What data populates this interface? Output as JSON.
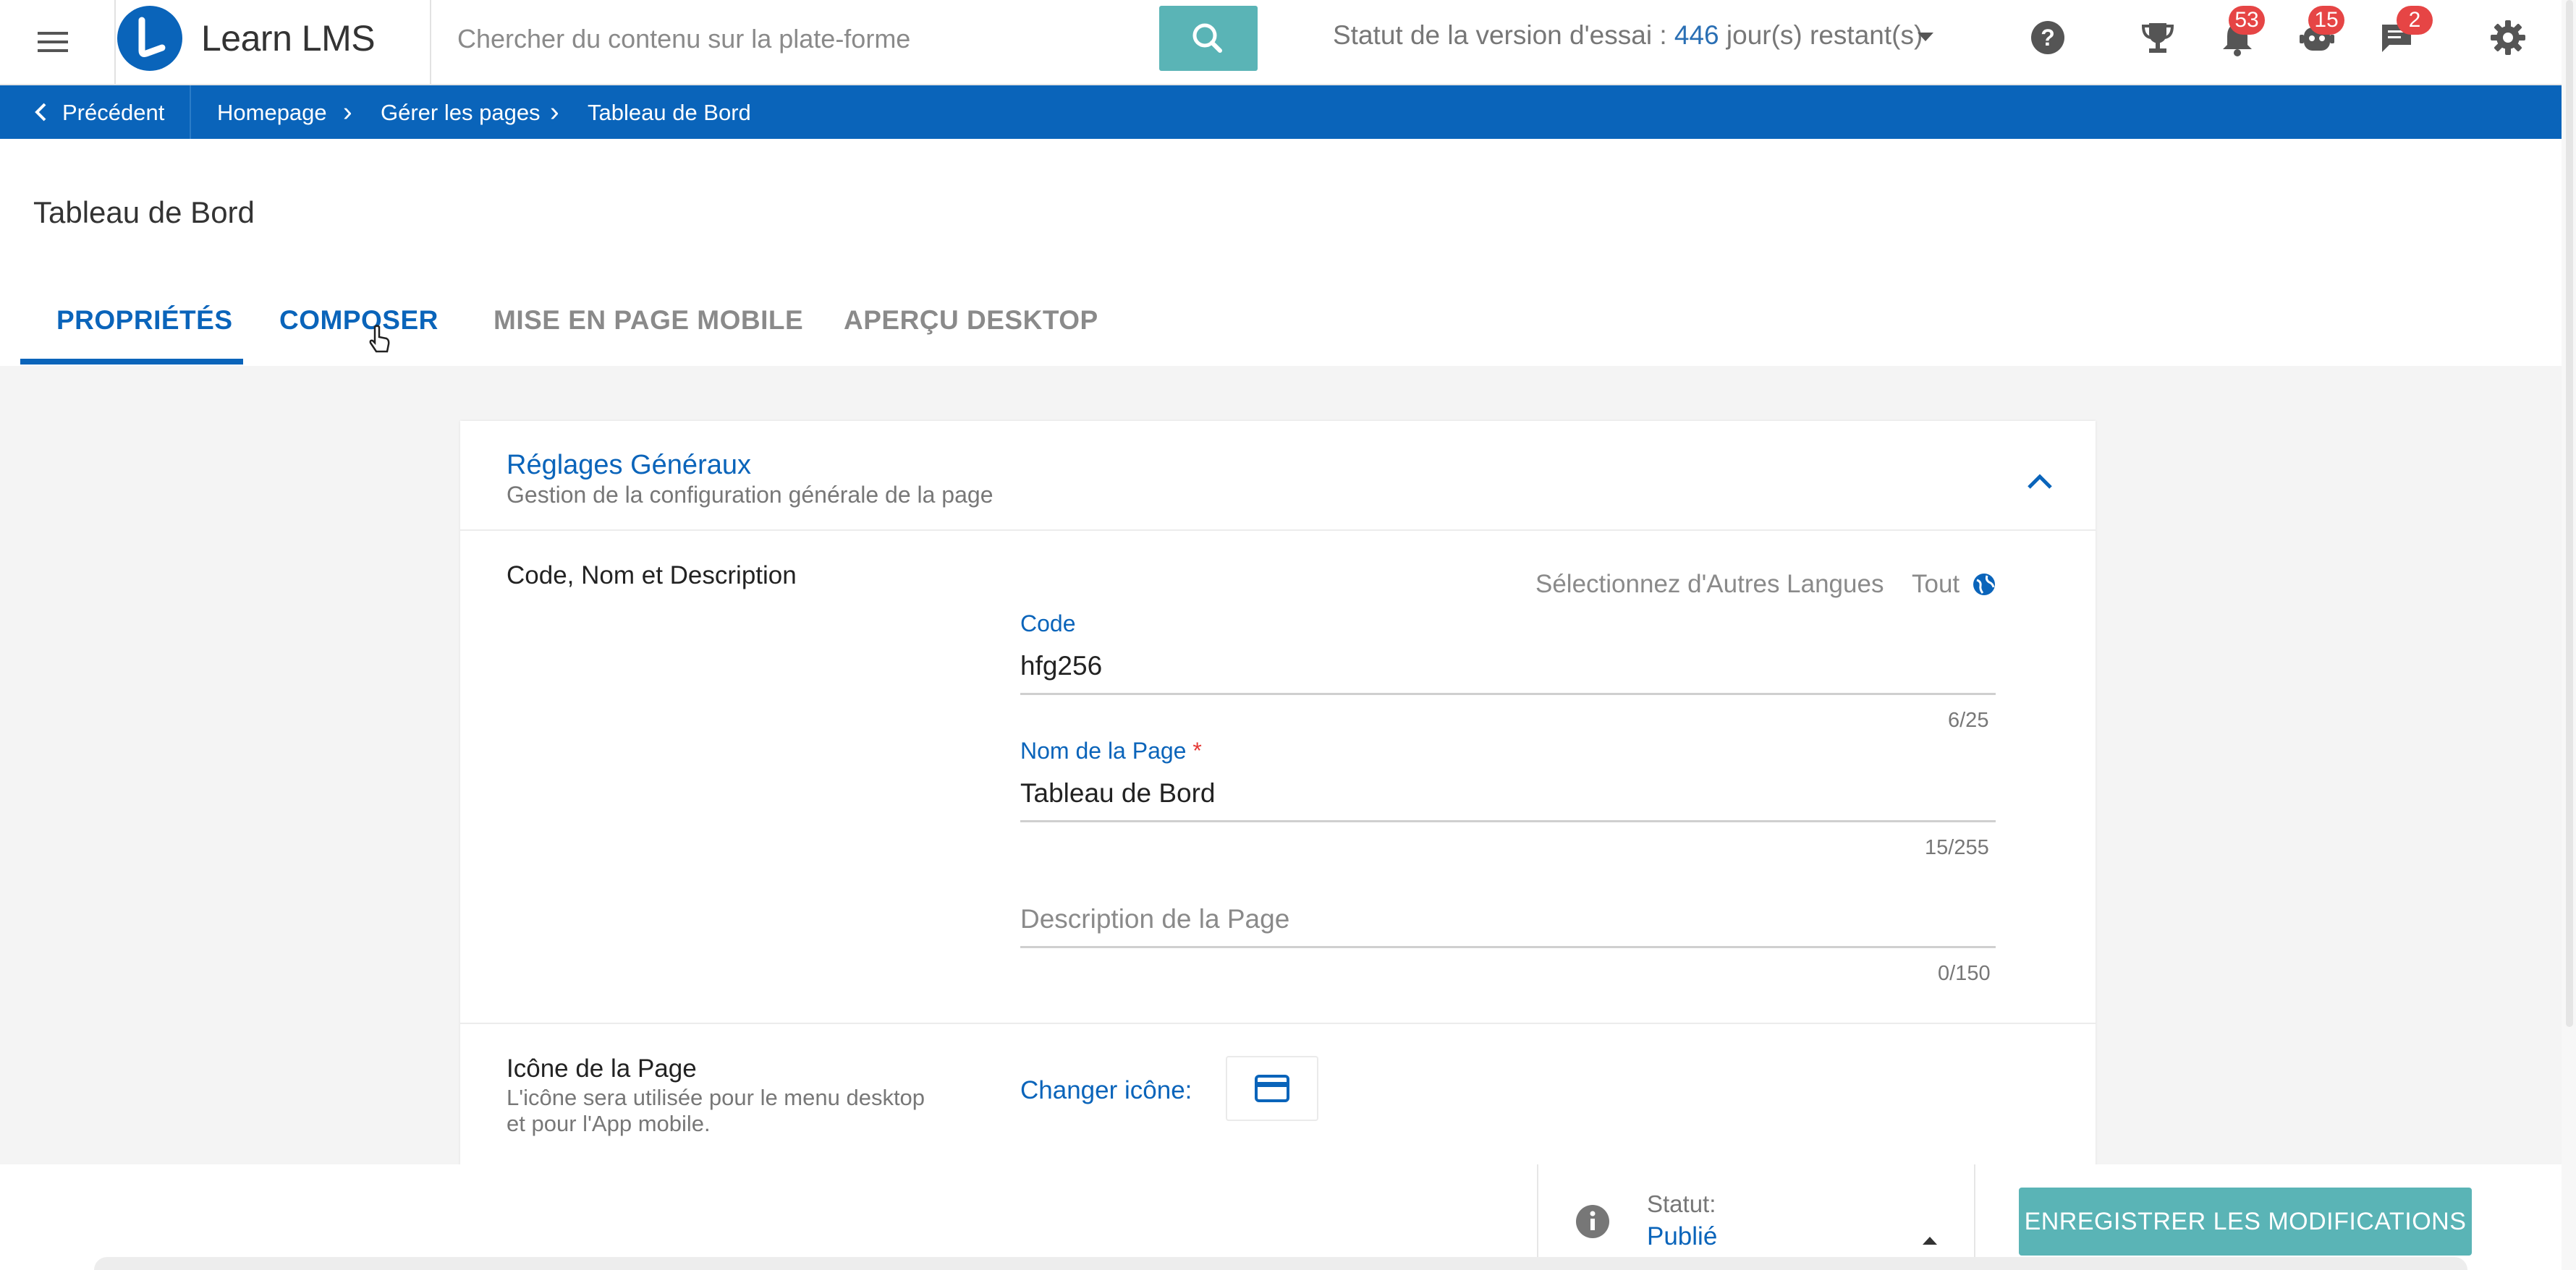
{
  "header": {
    "app_title": "Learn LMS",
    "search_placeholder": "Chercher du contenu sur la plate-forme",
    "trial_label": "Statut de la version d'essai : ",
    "trial_days": "446",
    "trial_suffix": " jour(s) restant(s)",
    "icons": [
      "menu-icon",
      "search-icon",
      "chevron-down-icon",
      "help-icon",
      "trophy-icon",
      "bell-icon",
      "robot-icon",
      "chat-icon",
      "gear-icon"
    ],
    "badges": {
      "notifications": "53",
      "bot": "15",
      "messages": "2"
    }
  },
  "breadcrumb": {
    "back_label": "Précédent",
    "items": [
      "Homepage",
      "Gérer les pages",
      "Tableau de Bord"
    ]
  },
  "page": {
    "title": "Tableau de Bord",
    "tabs": [
      "PROPRIÉTÉS",
      "COMPOSER",
      "MISE EN PAGE MOBILE",
      "APERÇU DESKTOP"
    ],
    "active_tab": "PROPRIÉTÉS"
  },
  "section": {
    "title": "Réglages Généraux",
    "subtitle": "Gestion de la configuration générale de la page",
    "code_name_desc_label": "Code, Nom et Description",
    "other_languages_label": "Sélectionnez d'Autres Langues",
    "language_value": "Tout",
    "code": {
      "label": "Code",
      "value": "hfg256",
      "counter": "6/25"
    },
    "name": {
      "label": "Nom de la Page",
      "required_mark": "*",
      "value": "Tableau de Bord",
      "counter": "15/255"
    },
    "description": {
      "placeholder": "Description de la Page",
      "counter": "0/150"
    },
    "icon_label": "Icône de la Page",
    "icon_hint_line1": "L'icône sera utilisée pour le menu desktop",
    "icon_hint_line2": "et pour l'App mobile.",
    "change_icon_label": "Changer icône:"
  },
  "footer": {
    "status_label": "Statut:",
    "status_value": "Publié",
    "save_label": "ENREGISTRER LES MODIFICATIONS"
  },
  "colors": {
    "primary": "#0a64ba",
    "accent_teal": "#5ab4b6",
    "badge_red": "#e64545",
    "required_red": "#e53935"
  }
}
